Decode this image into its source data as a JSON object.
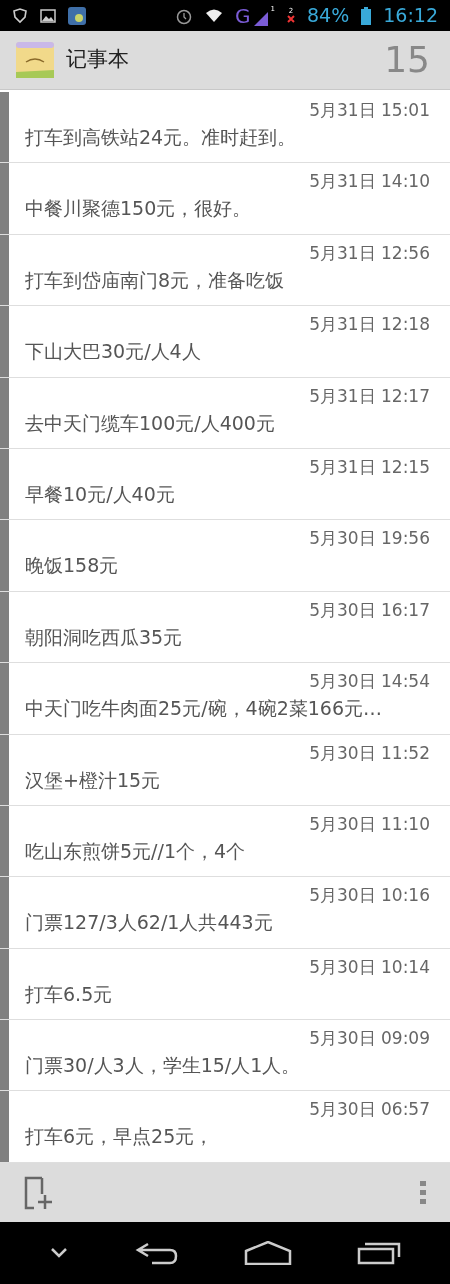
{
  "status_bar": {
    "battery": "84%",
    "time": "16:12",
    "signal_network": "G",
    "sim_1": "1",
    "sim_2": "2"
  },
  "header": {
    "title": "记事本",
    "count": "15"
  },
  "notes": [
    {
      "time": "5月31日 15:01",
      "text": "打车到高铁站24元。准时赶到。"
    },
    {
      "time": "5月31日 14:10",
      "text": "中餐川聚德150元，很好。"
    },
    {
      "time": "5月31日 12:56",
      "text": "打车到岱庙南门8元，准备吃饭"
    },
    {
      "time": "5月31日 12:18",
      "text": "下山大巴30元/人4人"
    },
    {
      "time": "5月31日 12:17",
      "text": "去中天门缆车100元/人400元"
    },
    {
      "time": "5月31日 12:15",
      "text": "早餐10元/人40元"
    },
    {
      "time": "5月30日 19:56",
      "text": "晚饭158元"
    },
    {
      "time": "5月30日 16:17",
      "text": "朝阳洞吃西瓜35元"
    },
    {
      "time": "5月30日 14:54",
      "text": "中天门吃牛肉面25元/碗，4碗2菜166元…"
    },
    {
      "time": "5月30日 11:52",
      "text": "汉堡+橙汁15元"
    },
    {
      "time": "5月30日 11:10",
      "text": "吃山东煎饼5元//1个，4个"
    },
    {
      "time": "5月30日 10:16",
      "text": "门票127/3人62/1人共443元"
    },
    {
      "time": "5月30日 10:14",
      "text": "打车6.5元"
    },
    {
      "time": "5月30日 09:09",
      "text": "门票30/人3人，学生15/人1人。"
    },
    {
      "time": "5月30日 06:57",
      "text": "打车6元，早点25元，"
    }
  ]
}
